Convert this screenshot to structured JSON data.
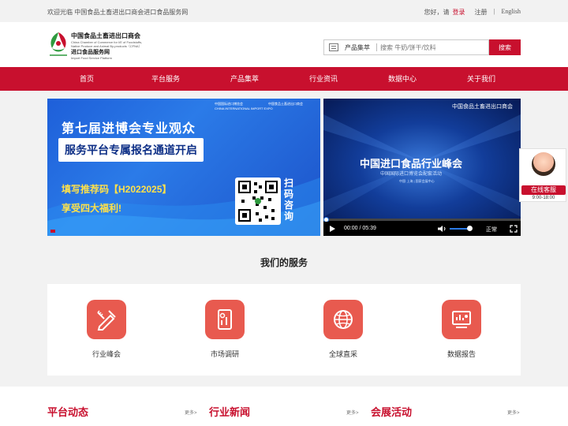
{
  "topbar": {
    "welcome": "欢迎光临 中国食品土畜进出口商会进口食品服务网",
    "greeting": "您好，请",
    "login": "登录",
    "register": "注册",
    "sep": "|",
    "english": "English"
  },
  "logo": {
    "org_cn": "中国食品土畜进出口商会",
    "org_en": "China Chamber of Commerce for I/E of Foodstuffs, Native Produce and Animal By-products（CFNA）",
    "platform_cn": "进口食品服务网",
    "platform_en": "Import Food Service Platform"
  },
  "search": {
    "category": "产品集萃",
    "placeholder": "搜索 牛奶/饼干/饮料",
    "button": "搜索"
  },
  "nav": [
    {
      "label": "首页"
    },
    {
      "label": "平台服务"
    },
    {
      "label": "产品集萃"
    },
    {
      "label": "行业资讯"
    },
    {
      "label": "数据中心"
    },
    {
      "label": "关于我们"
    }
  ],
  "banner_left": {
    "title": "第七届进博会专业观众",
    "subtitle": "服务平台专属报名通道开启",
    "code_line": "填写推荐码【H2022025】",
    "perk_line": "享受四大福利!",
    "scan": "扫码咨询",
    "expo_name": "中国国际进口博览会",
    "expo_en": "CHINA INTERNATIONAL IMPORT EXPO",
    "chamber_name": "中国食品土畜进出口商会"
  },
  "video": {
    "org": "中国食品土畜进出口商会",
    "title": "中国进口食品行业峰会",
    "subtitle": "中国国际进口博览会配套活动",
    "location": "中国·上海 | 国家会展中心",
    "time": "00:00 / 05:39",
    "speed": "正常",
    "progress": 0
  },
  "service_widget": {
    "button": "在线客服",
    "hours": "9:00-18:00"
  },
  "services_section": {
    "title": "我们的服务",
    "items": [
      {
        "label": "行业峰会",
        "icon": "pen-ruler-icon"
      },
      {
        "label": "市场调研",
        "icon": "document-icon"
      },
      {
        "label": "全球直采",
        "icon": "globe-icon"
      },
      {
        "label": "数据报告",
        "icon": "report-icon"
      }
    ]
  },
  "news_columns": [
    {
      "title": "平台动态",
      "more": "更多>"
    },
    {
      "title": "行业新闻",
      "more": "更多>"
    },
    {
      "title": "会展活动",
      "more": "更多>"
    }
  ],
  "colors": {
    "brand_red": "#c8102e",
    "icon_red": "#e85a4f",
    "banner_blue": "#1e5fd9"
  }
}
